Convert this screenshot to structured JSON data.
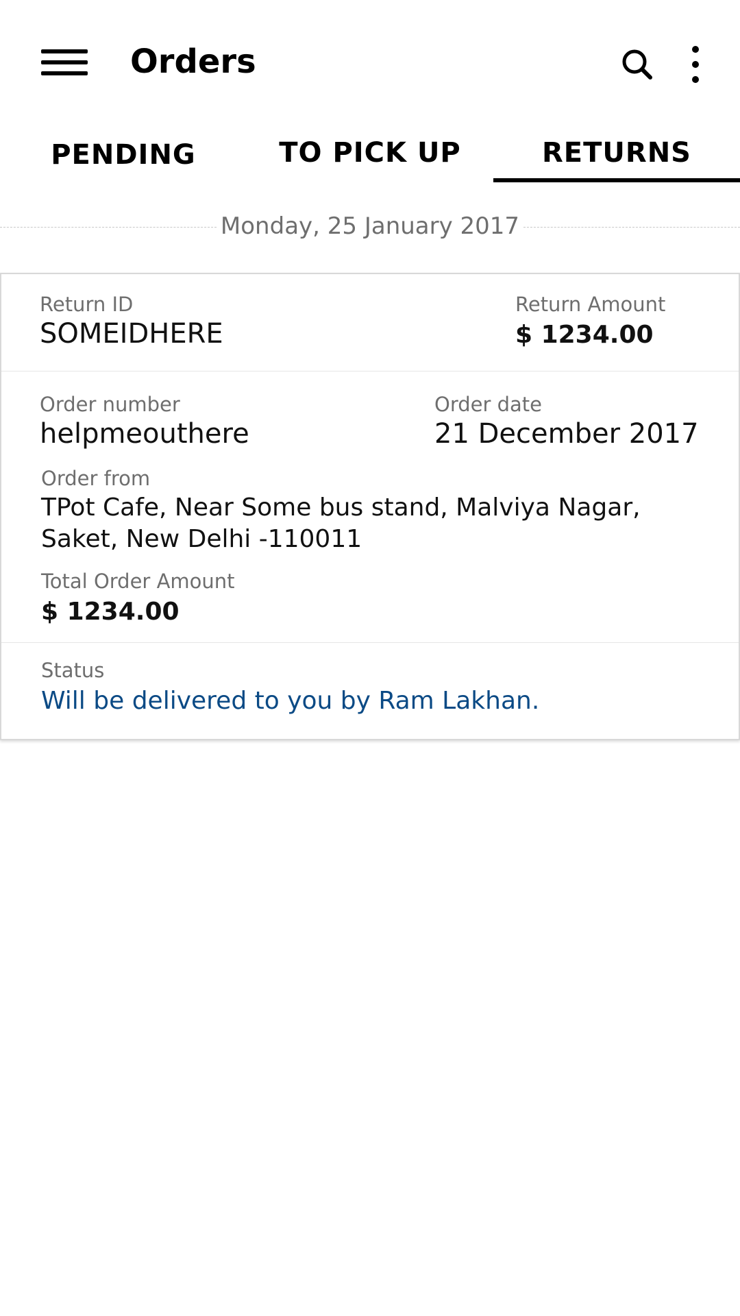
{
  "app_bar": {
    "title": "Orders",
    "icons": {
      "menu": "hamburger-menu-icon",
      "search": "search-icon",
      "more": "more-vert-icon"
    }
  },
  "tabs": [
    {
      "label": "PENDING",
      "selected": false
    },
    {
      "label": "TO PICK UP",
      "selected": false
    },
    {
      "label": "RETURNS",
      "selected": true
    }
  ],
  "date_separator": "Monday, 25 January 2017",
  "return_card": {
    "return_id_label": "Return ID",
    "return_id": "SOMEIDHERE",
    "return_amount_label": "Return Amount",
    "return_amount": "$ 1234.00",
    "order_number_label": "Order number",
    "order_number": "helpmeouthere",
    "order_date_label": "Order date",
    "order_date": "21 December 2017",
    "order_from_label": "Order from",
    "order_from": "TPot Cafe, Near Some bus stand, Malviya Nagar, Saket, New Delhi -110011",
    "total_amount_label": "Total Order Amount",
    "total_amount": "$ 1234.00",
    "status_label": "Status",
    "status": "Will be delivered to you by Ram Lakhan."
  },
  "colors": {
    "status_text": "#0b4a85",
    "label_text": "#6e6e6e",
    "tab_indicator": "#000000"
  }
}
